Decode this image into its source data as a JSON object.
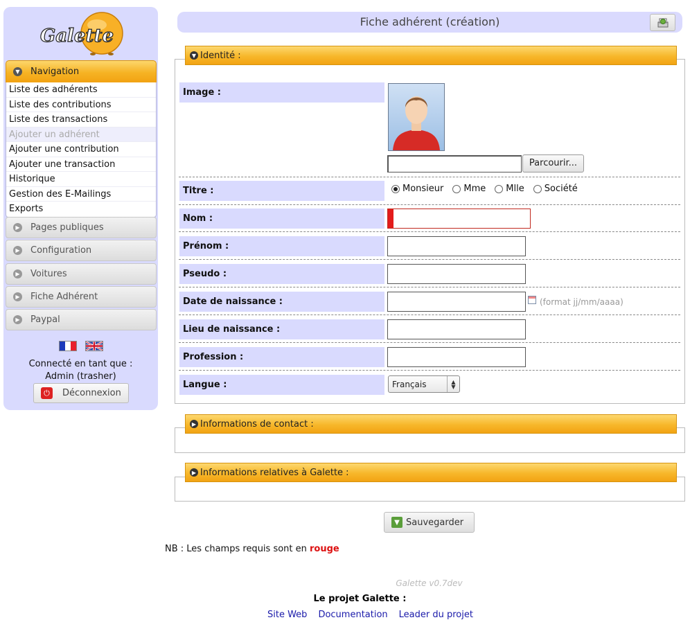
{
  "sidebar": {
    "logo_text": "Galette",
    "nav_title": "Navigation",
    "nav_items": [
      {
        "label": "Liste des adhérents"
      },
      {
        "label": "Liste des contributions"
      },
      {
        "label": "Liste des transactions"
      },
      {
        "label": "Ajouter un adhérent",
        "active": true
      },
      {
        "label": "Ajouter une contribution"
      },
      {
        "label": "Ajouter une transaction"
      },
      {
        "label": "Historique"
      },
      {
        "label": "Gestion des E-Mailings"
      },
      {
        "label": "Exports"
      }
    ],
    "collapsed_sections": [
      {
        "label": "Pages publiques"
      },
      {
        "label": "Configuration"
      },
      {
        "label": "Voitures"
      },
      {
        "label": "Fiche Adhérent"
      },
      {
        "label": "Paypal"
      }
    ],
    "login_line1": "Connecté en tant que :",
    "login_line2": "Admin (trasher)",
    "logout_label": "Déconnexion"
  },
  "page": {
    "title": "Fiche adhérent (création)"
  },
  "identity": {
    "legend": "Identité :",
    "image_label": "Image :",
    "browse_label": "Parcourir...",
    "titre_label": "Titre :",
    "titre_options": [
      {
        "label": "Monsieur",
        "checked": true
      },
      {
        "label": "Mme",
        "checked": false
      },
      {
        "label": "Mlle",
        "checked": false
      },
      {
        "label": "Société",
        "checked": false
      }
    ],
    "nom_label": "Nom :",
    "prenom_label": "Prénom :",
    "pseudo_label": "Pseudo :",
    "naissance_label": "Date de naissance :",
    "date_format_hint": "(format jj/mm/aaaa)",
    "lieu_label": "Lieu de naissance :",
    "profession_label": "Profession :",
    "langue_label": "Langue :",
    "langue_value": "Français"
  },
  "contact": {
    "legend": "Informations de contact :"
  },
  "galette_info": {
    "legend": "Informations relatives à Galette :"
  },
  "save_label": "Sauvegarder",
  "note": {
    "prefix": "NB : Les champs requis sont en ",
    "highlight": "rouge"
  },
  "footer": {
    "version": "Galette v0.7dev",
    "project_title": "Le projet Galette :",
    "links": [
      "Site Web",
      "Documentation",
      "Leader du projet"
    ]
  },
  "colors": {
    "sidebar_bg": "#d9dafe",
    "accent_orange": "#f6b324",
    "required_red": "#e31b1b",
    "link_blue": "#1a1aaa"
  }
}
